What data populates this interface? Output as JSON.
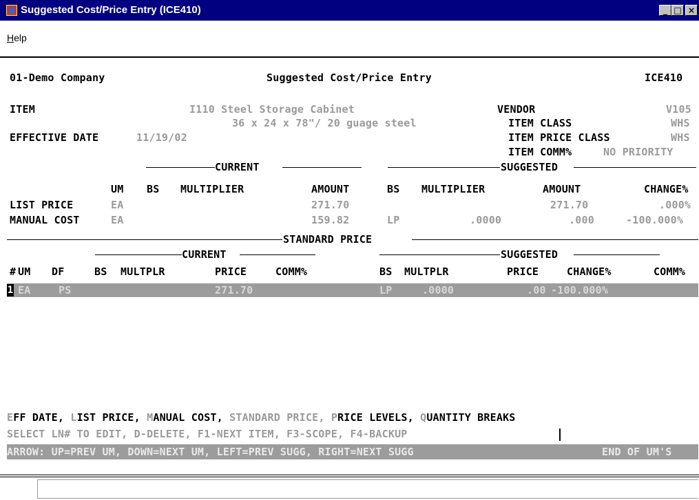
{
  "window": {
    "title": "Suggested Cost/Price Entry (ICE410)",
    "minimize_glyph": "_",
    "maximize_glyph": "□",
    "close_glyph": "×",
    "icon": "app-icon"
  },
  "menu": {
    "help_first": "H",
    "help_rest": "elp"
  },
  "header": {
    "company": "01-Demo Company",
    "screen_title": "Suggested Cost/Price Entry",
    "program": "ICE410"
  },
  "item": {
    "label": "ITEM",
    "value_line1": "I110 Steel Storage Cabinet",
    "value_line2": "36 x 24 x 78\"/ 20 guage steel"
  },
  "effective_date": {
    "label": "EFFECTIVE DATE",
    "value": "11/19/02"
  },
  "vendor": {
    "label": "VENDOR",
    "value": "V105"
  },
  "item_class": {
    "label": "ITEM CLASS",
    "value": "WHS"
  },
  "item_price_class": {
    "label": "ITEM PRICE CLASS",
    "value": "WHS"
  },
  "item_comm": {
    "label": "ITEM COMM%",
    "value": "NO PRIORITY"
  },
  "cost_section": {
    "current_label": "CURRENT",
    "suggested_label": "SUGGESTED",
    "col_um": "UM",
    "col_bs": "BS",
    "col_multiplier": "MULTIPLIER",
    "col_amount": "AMOUNT",
    "col_bs2": "BS",
    "col_multiplier2": "MULTIPLIER",
    "col_amount2": "AMOUNT",
    "col_change": "CHANGE%",
    "rows": [
      {
        "label": "LIST PRICE",
        "um": "EA",
        "amount": "271.70",
        "s_bs": "",
        "s_mult": "",
        "s_amount": "271.70",
        "change": ".000%"
      },
      {
        "label": "MANUAL COST",
        "um": "EA",
        "amount": "159.82",
        "s_bs": "LP",
        "s_mult": ".0000",
        "s_amount": ".000",
        "change": "-100.000%"
      }
    ]
  },
  "standard_price": {
    "title": "STANDARD PRICE",
    "current_label": "CURRENT",
    "suggested_label": "SUGGESTED",
    "h_ln": "#",
    "h_um": "UM",
    "h_df": "DF",
    "h_bs": "BS",
    "h_multplr": "MULTPLR",
    "h_price": "PRICE",
    "h_comm": "COMM%",
    "h_bs2": "BS",
    "h_multplr2": "MULTPLR",
    "h_price2": "PRICE",
    "h_change": "CHANGE%",
    "h_comm2": "COMM%",
    "rows": [
      {
        "ln": "1",
        "um": "EA",
        "df": "PS",
        "price": "271.70",
        "s_bs": "LP",
        "s_mult": ".0000",
        "s_price": ".00",
        "change": "-100.000%"
      }
    ]
  },
  "commands": {
    "eff_first": "E",
    "eff_rest": "FF DATE,",
    "list_first": "L",
    "list_rest": "IST PRICE,",
    "man_first": "M",
    "man_rest": "ANUAL COST,",
    "std": "STANDARD PRICE,",
    "lev_first": "P",
    "lev_rest": "RICE LEVELS,",
    "qty_first": "Q",
    "qty_rest": "UANTITY BREAKS"
  },
  "prompt": "SELECT LN# TO EDIT, D-DELETE, F1-NEXT ITEM, F3-SCOPE, F4-BACKUP",
  "status": {
    "arrow_help": "ARROW: UP=PREV UM, DOWN=NEXT UM, LEFT=PREV SUGG, RIGHT=NEXT SUGG",
    "end_msg": "END OF UM'S"
  }
}
